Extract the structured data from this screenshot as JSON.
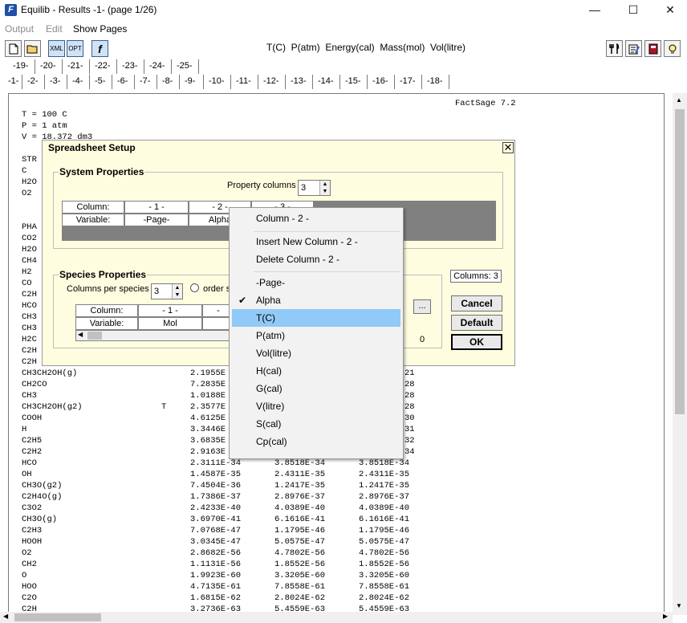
{
  "window": {
    "title": "Equilib - Results  -1-  (page 1/26)",
    "minimize": "—",
    "maximize": "☐",
    "close": "✕"
  },
  "menu": [
    "Output",
    "Edit",
    "Show Pages"
  ],
  "toolbar": {
    "units": "T(C)  P(atm)  Energy(cal)  Mass(mol)  Vol(litre)",
    "xml_label": "XML",
    "opt_label": "OPT",
    "f_label": "f"
  },
  "page_tabs_row1": [
    "-19-",
    "-20-",
    "-21-",
    "-22-",
    "-23-",
    "-24-",
    "-25-"
  ],
  "page_tabs_row2": [
    "-1-",
    "-2-",
    "-3-",
    "-4-",
    "-5-",
    "-6-",
    "-7-",
    "-8-",
    "-9-",
    "-10-",
    "-11-",
    "-12-",
    "-13-",
    "-14-",
    "-15-",
    "-16-",
    "-17-",
    "-18-"
  ],
  "output": {
    "factsage": "FactSage 7.2",
    "header_lines": [
      "T = 100 C",
      "P = 1 atm",
      "V = 18.372 dm3"
    ],
    "left_labels": [
      "STR",
      "C",
      "H2O",
      "O2",
      "PHA",
      "CO2",
      "H2O",
      "CH4",
      "H2",
      "CO",
      "C2H",
      "HCO",
      "CH3",
      "CH3",
      "H2C",
      "C2H",
      "C2H"
    ],
    "partial_right": [
      "21",
      "28",
      "28",
      "28",
      "30",
      "31",
      "32",
      "34"
    ],
    "rows": [
      [
        "CH3CH2OH(g)",
        "",
        "2.1955E",
        "",
        ""
      ],
      [
        "CH2CO",
        "",
        "7.2835E",
        "",
        ""
      ],
      [
        "CH3",
        "",
        "1.0188E",
        "",
        ""
      ],
      [
        "CH3CH2OH(g2)",
        "T",
        "2.3577E",
        "",
        ""
      ],
      [
        "COOH",
        "",
        "4.6125E",
        "",
        ""
      ],
      [
        "H",
        "",
        "3.3446E",
        "",
        ""
      ],
      [
        "C2H5",
        "",
        "3.6835E",
        "",
        ""
      ],
      [
        "C2H2",
        "",
        "2.9163E",
        "",
        ""
      ],
      [
        "HCO",
        "",
        "2.3111E-34",
        "3.8518E-34",
        "3.8518E-34"
      ],
      [
        "OH",
        "",
        "1.4587E-35",
        "2.4311E-35",
        "2.4311E-35"
      ],
      [
        "CH3O(g2)",
        "",
        "7.4504E-36",
        "1.2417E-35",
        "1.2417E-35"
      ],
      [
        "C2H4O(g)",
        "",
        "1.7386E-37",
        "2.8976E-37",
        "2.8976E-37"
      ],
      [
        "C3O2",
        "",
        "2.4233E-40",
        "4.0389E-40",
        "4.0389E-40"
      ],
      [
        "CH3O(g)",
        "",
        "3.6970E-41",
        "6.1616E-41",
        "6.1616E-41"
      ],
      [
        "C2H3",
        "",
        "7.0768E-47",
        "1.1795E-46",
        "1.1795E-46"
      ],
      [
        "HOOH",
        "",
        "3.0345E-47",
        "5.0575E-47",
        "5.0575E-47"
      ],
      [
        "O2",
        "",
        "2.8682E-56",
        "4.7802E-56",
        "4.7802E-56"
      ],
      [
        "CH2",
        "",
        "1.1131E-56",
        "1.8552E-56",
        "1.8552E-56"
      ],
      [
        "O",
        "",
        "1.9923E-60",
        "3.3205E-60",
        "3.3205E-60"
      ],
      [
        "HOO",
        "",
        "4.7135E-61",
        "7.8558E-61",
        "7.8558E-61"
      ],
      [
        "C2O",
        "",
        "1.6815E-62",
        "2.8024E-62",
        "2.8024E-62"
      ],
      [
        "C2H",
        "",
        "3.2736E-63",
        "5.4559E-63",
        "5.4559E-63"
      ]
    ]
  },
  "dialog": {
    "title": "Spreadsheet Setup",
    "close": "✕",
    "system": {
      "title": "System Properties",
      "property_columns_label": "Property columns",
      "property_columns_value": "3",
      "col_header": "Column:",
      "var_header": "Variable:",
      "columns": [
        "- 1 -",
        "- 2 -",
        "- 3 -"
      ],
      "variables": [
        "-Page-",
        "Alpha",
        ""
      ]
    },
    "species": {
      "title": "Species Properties",
      "columns_per_species_label": "Columns per species",
      "columns_per_species_value": "3",
      "order_label": "order s",
      "col_header": "Column:",
      "var_header": "Variable:",
      "columns": [
        "- 1 -",
        "-"
      ],
      "variables": [
        "Mol",
        ""
      ],
      "ellipsis": "...",
      "zero": "0"
    },
    "columns_total": "Columns:  3",
    "cancel": "Cancel",
    "default": "Default",
    "ok": "OK"
  },
  "context_menu": {
    "header": "Column -  2 -",
    "insert": "Insert New Column -  2 -",
    "delete": "Delete Column -  2 -",
    "options": [
      "-Page-",
      "Alpha",
      "T(C)",
      "P(atm)",
      "Vol(litre)",
      "H(cal)",
      "G(cal)",
      "V(litre)",
      "S(cal)",
      "Cp(cal)"
    ],
    "checked": "Alpha",
    "highlighted": "T(C)",
    "checkmark": "✔"
  },
  "colors": {
    "dialog_bg": "#fffde0",
    "menu_highlight": "#91c9f7",
    "grid_dark": "#808080"
  }
}
